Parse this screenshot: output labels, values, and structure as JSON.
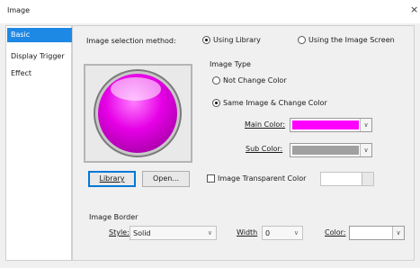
{
  "window": {
    "title": "Image",
    "close": "×"
  },
  "sidebar": {
    "items": [
      {
        "label": "Basic"
      },
      {
        "label": "Display Trigger"
      },
      {
        "label": "Effect"
      }
    ]
  },
  "selection": {
    "label": "Image selection method:",
    "options": [
      {
        "label": "Using Library",
        "checked": true
      },
      {
        "label": "Using the Image Screen",
        "checked": false
      }
    ]
  },
  "image_type": {
    "label": "Image Type",
    "options": [
      {
        "label": "Not Change Color",
        "checked": false
      },
      {
        "label": "Same Image & Change Color",
        "checked": true
      }
    ],
    "main_color_label": "Main Color:",
    "main_color": "#ff00ff",
    "sub_color_label": "Sub Color:",
    "sub_color": "#a0a0a0"
  },
  "buttons": {
    "library": "Library",
    "open": "Open..."
  },
  "transparent": {
    "label": "Image Transparent Color",
    "checked": false,
    "color": "#ffffff"
  },
  "border": {
    "label": "Image Border",
    "style_label": "Style:",
    "style_value": "Solid",
    "width_label": "Width",
    "width_value": "0",
    "color_label": "Color:",
    "color": "#ffffff"
  },
  "colors": {
    "accent": "#1e88e5",
    "lamp": "#e600e6"
  }
}
